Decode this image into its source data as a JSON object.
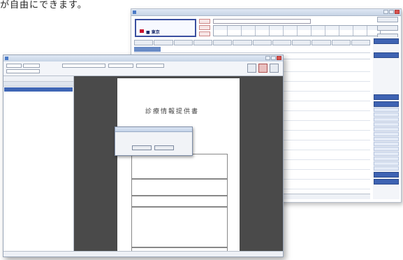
{
  "caption": "が自由にできます。",
  "back_window": {
    "patient_name": "■ 東京",
    "tabs": [
      "",
      "",
      "",
      "",
      "",
      "",
      "",
      "",
      "",
      "",
      "",
      ""
    ]
  },
  "front_window": {
    "document": {
      "title": "診療情報提供書"
    },
    "dialog": {
      "message": "",
      "ok_label": "",
      "cancel_label": ""
    }
  },
  "colors": {
    "accent_blue": "#3e63b3",
    "viewer_bg": "#4a4a4a",
    "window_frame": "#9aa6b8"
  }
}
